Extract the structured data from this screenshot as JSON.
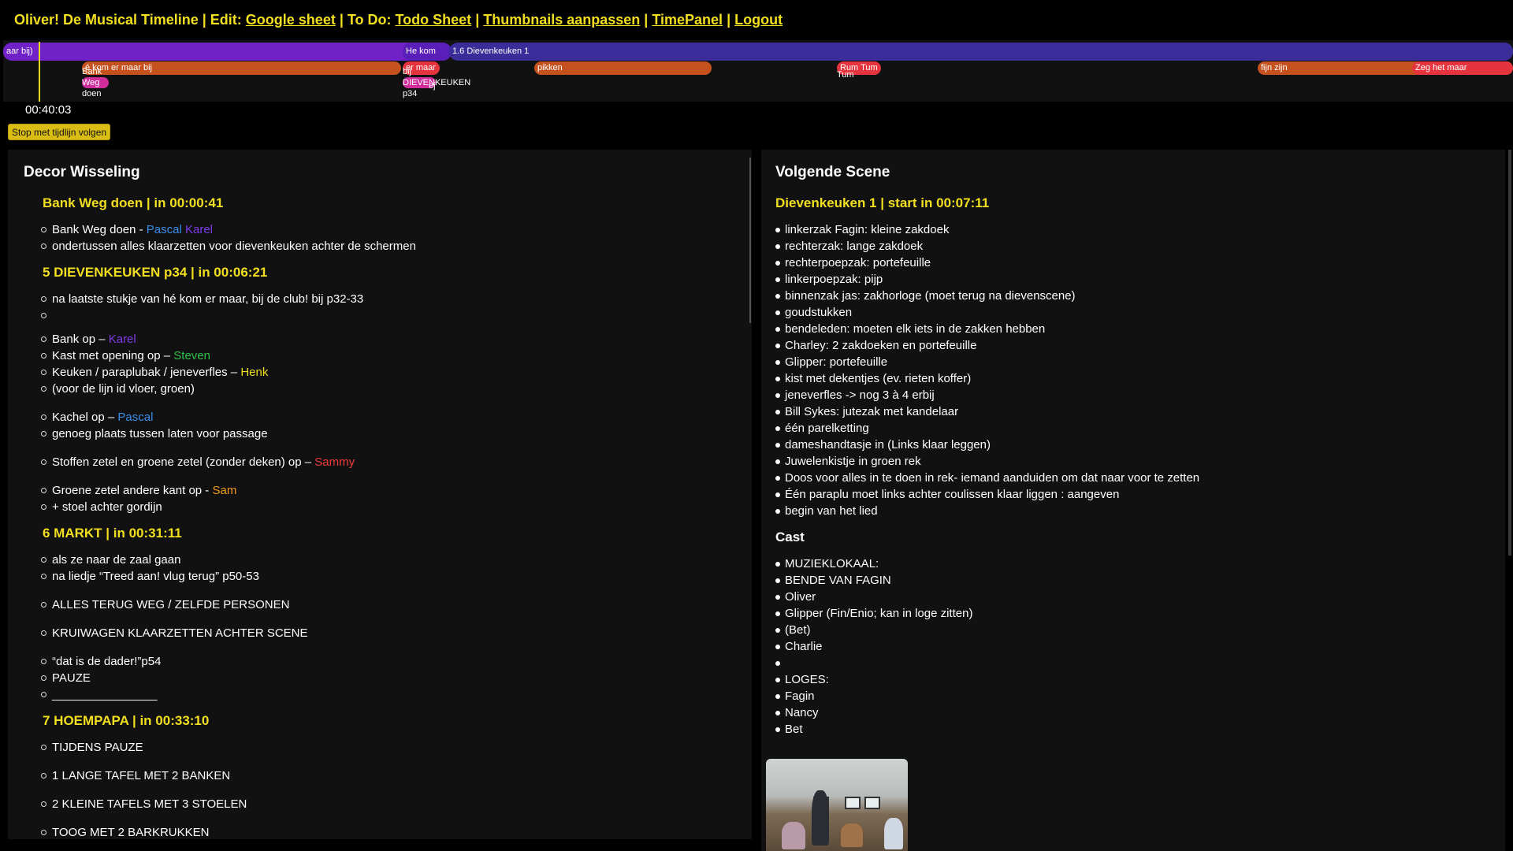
{
  "header": {
    "title": "Oliver! De Musical Timeline | Edit: ",
    "google_sheet": "Google sheet",
    "sep1": " | To Do: ",
    "todo_sheet": "Todo Sheet",
    "sep2": " | ",
    "thumbnails": "Thumbnails aanpassen",
    "sep3": " | ",
    "timepanel": "TimePanel",
    "sep4": " | ",
    "logout": "Logout"
  },
  "timeline": {
    "bars": {
      "b1": "aar bij)",
      "b2": "He kom",
      "b3": "1.6 Dievenkeuken 1",
      "b4": "é kom er maar bij",
      "b5": "er maar",
      "b6": "pikken",
      "b7": "Rum Tum",
      "b8": "fijn zijn",
      "b9": "Zeg het maar"
    },
    "labels": {
      "l1": "Bank",
      "l2": "Weg",
      "l3": "doen",
      "l4": "bij",
      "l5": "DIEVENKEUKEN",
      "l6": "p34",
      "l7": "Tum",
      "l8": "ej"
    },
    "current_time": "00:40:03",
    "follow_button": "Stop met tijdlijn volgen"
  },
  "left_panel": {
    "title": "Decor Wisseling",
    "s1_title": "Bank Weg doen | in 00:00:41",
    "s1_i1_a": "Bank Weg doen - ",
    "s1_i1_b": "Pascal",
    "s1_i1_c": "Karel",
    "s1_i2": "ondertussen alles klaarzetten voor dievenkeuken achter de schermen",
    "s2_title": "5 DIEVENKEUKEN p34 | in 00:06:21",
    "s2_i1": "na laatste stukje van hé kom er maar, bij de club! bij p32-33",
    "s2_i2_a": "Bank op – ",
    "s2_i2_b": "Karel",
    "s2_i3_a": "Kast met opening op – ",
    "s2_i3_b": "Steven",
    "s2_i4_a": "Keuken / paraplubak / jeneverfles – ",
    "s2_i4_b": "Henk",
    "s2_i5": "(voor de lijn id vloer, groen)",
    "s2_i6_a": "Kachel op – ",
    "s2_i6_b": "Pascal",
    "s2_i7": "genoeg plaats tussen laten voor passage",
    "s2_i8_a": "Stoffen zetel en groene zetel (zonder deken) op – ",
    "s2_i8_b": "Sammy",
    "s2_i9_a": "Groene zetel andere kant op - ",
    "s2_i9_b": "Sam",
    "s2_i10": "+ stoel achter gordijn",
    "s3_title": "6 MARKT | in 00:31:11",
    "s3_i1": "als ze naar de zaal gaan",
    "s3_i2": "na liedje “Treed aan! vlug terug” p50-53",
    "s3_i3": "ALLES TERUG WEG / ZELFDE PERSONEN",
    "s3_i4": "KRUIWAGEN KLAARZETTEN ACHTER SCENE",
    "s3_i5": "“dat is de dader!”p54",
    "s3_i6": "PAUZE",
    "s3_i7": "________________",
    "s4_title": "7 HOEMPAPA | in 00:33:10",
    "s4_i1": "TIJDENS PAUZE",
    "s4_i2": "1 LANGE TAFEL MET 2 BANKEN",
    "s4_i3": "2 KLEINE TAFELS MET 3 STOELEN",
    "s4_i4": "TOOG MET 2 BARKRUKKEN"
  },
  "right_panel": {
    "title": "Volgende Scene",
    "scene_title": "Dievenkeuken 1 | start in 00:07:11",
    "items": [
      "linkerzak Fagin: kleine zakdoek",
      "rechterzak: lange zakdoek",
      "rechterpoepzak: portefeuille",
      "linkerpoepzak: pijp",
      "binnenzak jas: zakhorloge (moet terug na dievenscene)",
      "goudstukken",
      "bendeleden: moeten elk iets in de zakken hebben",
      "Charley: 2 zakdoeken en portefeuille",
      "Glipper: portefeuille",
      "kist met dekentjes (ev. rieten koffer)",
      "jeneverfles -> nog 3 à 4 erbij",
      "Bill Sykes: jutezak met kandelaar",
      "één parelketting",
      "dameshandtasje in (Links klaar leggen)",
      "Juwelenkistje in groen rek",
      "Doos voor alles in te doen in rek- iemand aanduiden om dat naar voor te zetten",
      "Één paraplu moet links achter coulissen klaar liggen : aangeven",
      "begin van het lied"
    ],
    "cast_title": "Cast",
    "cast": [
      "MUZIEKLOKAAL:",
      "BENDE VAN FAGIN",
      "Oliver",
      "Glipper (Fin/Enio; kan in loge zitten)",
      "(Bet)",
      "Charlie",
      "",
      "LOGES:",
      "Fagin",
      "Nancy",
      "Bet"
    ]
  },
  "colors": {
    "accent_yellow": "#f2df1f",
    "timeline_purple": "#7022c8",
    "timeline_navy": "#3a2d9a",
    "timeline_orange": "#c5521e",
    "timeline_red": "#e6343e",
    "panel_bg": "#111111",
    "name_blue": "#3a8de8",
    "name_purple": "#7d3ce8",
    "name_green": "#2ec24a",
    "name_red": "#f03a3a",
    "name_orange": "#f09a1c"
  }
}
